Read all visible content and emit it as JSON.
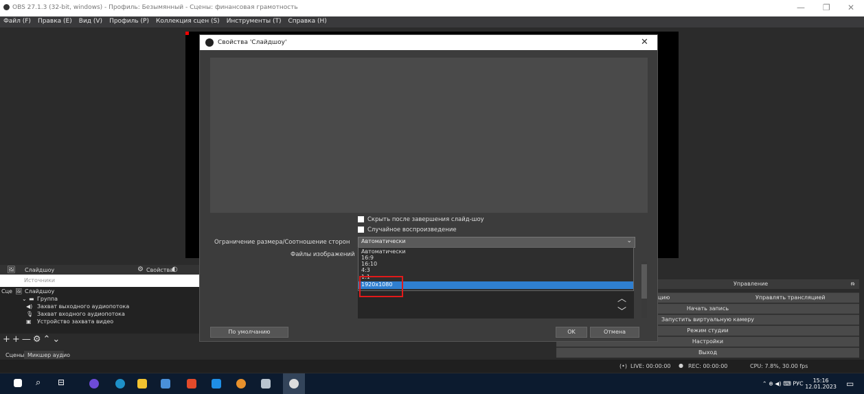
{
  "window": {
    "title": "OBS 27.1.3 (32-bit, windows) - Профиль: Безымянный - Сцены: финансовая грамотность"
  },
  "menu": [
    "Файл (F)",
    "Правка (E)",
    "Вид (V)",
    "Профиль (P)",
    "Коллекция сцен (S)",
    "Инструменты (T)",
    "Справка (H)"
  ],
  "dialog": {
    "title": "Свойства 'Слайдшоу'",
    "checkbox_hide": "Скрыть после завершения слайд-шоу",
    "checkbox_random": "Случайное воспроизведение",
    "aspect_label": "Ограничение размера/Соотношение сторон",
    "aspect_value": "Автоматически",
    "files_label": "Файлы изображений",
    "options": [
      "Автоматически",
      "16:9",
      "16:10",
      "4:3",
      "1:1",
      "1920x1080"
    ],
    "selected_option": "1920x1080",
    "defaults_button": "По умолчанию",
    "ok_button": "OK",
    "cancel_button": "Отмена"
  },
  "scene_bar": {
    "source_name": "Слайдшоу",
    "properties": "Свойства"
  },
  "sources_header": "Источники",
  "scenes_label": "Сце",
  "tree": [
    "Слайдшоу",
    "Группа",
    "Захват выходного аудиопотока",
    "Захват входного аудиопотока",
    "Устройство захвата видео"
  ],
  "dock_tabs": [
    "Сцены",
    "Микшер аудио"
  ],
  "controls": {
    "header": "Управление",
    "stream_partial": "цию",
    "stream_manage": "Управлять трансляцией",
    "start_record": "Начать запись",
    "virtual_cam": "Запустить виртуальную камеру",
    "studio_mode": "Режим студии",
    "settings": "Настройки",
    "exit": "Выход"
  },
  "status": {
    "live": "LIVE: 00:00:00",
    "rec": "REC: 00:00:00",
    "cpu": "CPU: 7.8%, 30.00 fps"
  },
  "tray": {
    "lang": "РУС",
    "time": "15:16",
    "date": "12.01.2023"
  }
}
